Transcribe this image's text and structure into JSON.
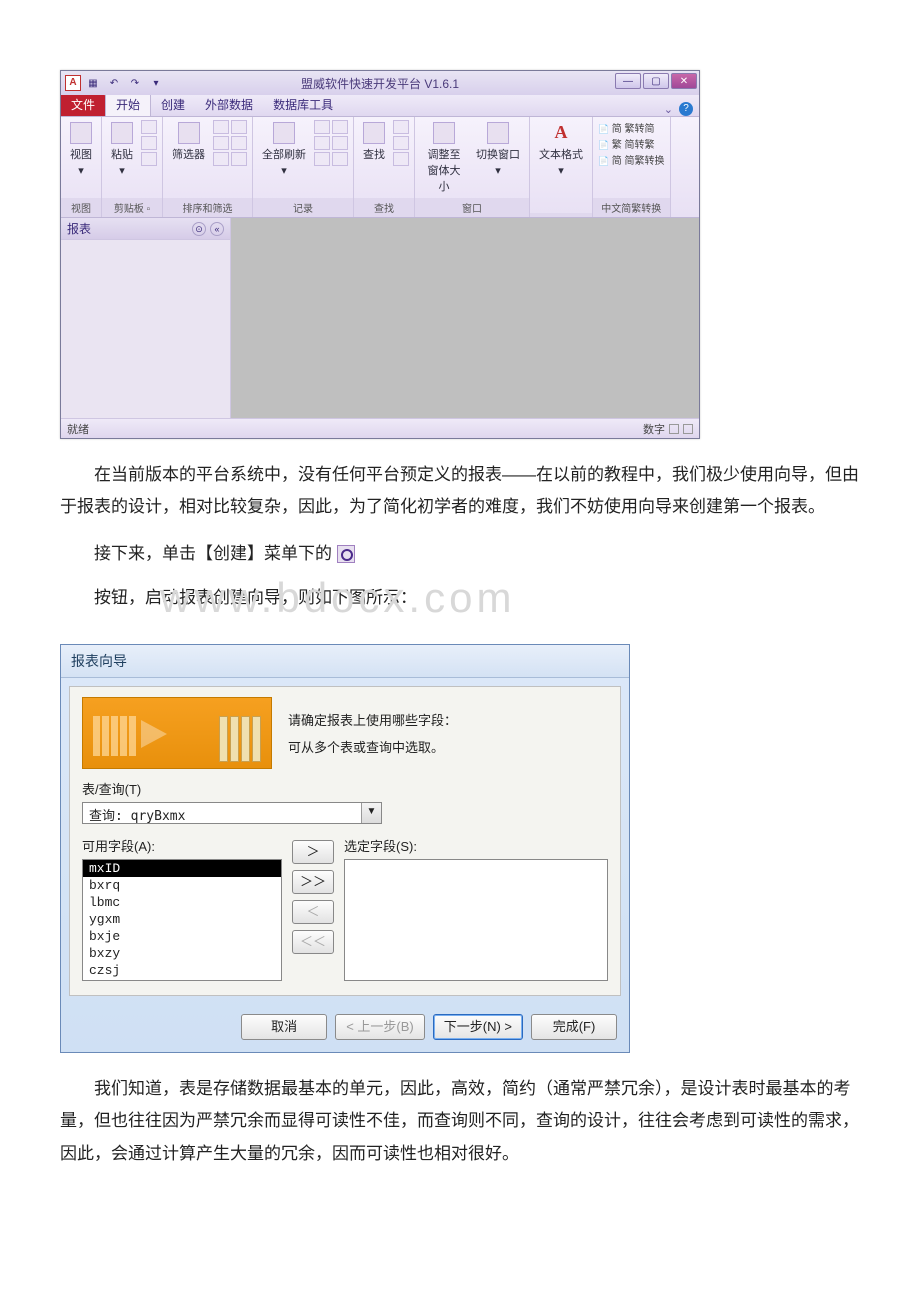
{
  "app": {
    "title": "盟威软件快速开发平台 V1.6.1",
    "logo_letter": "A",
    "qat": {
      "save": "▦",
      "undo": "↶",
      "redo": "↷",
      "more": "▾"
    },
    "win_controls": {
      "min": "—",
      "max": "▢",
      "close": "✕"
    }
  },
  "ribbon": {
    "tabs": {
      "file": "文件",
      "home": "开始",
      "create": "创建",
      "external": "外部数据",
      "dbtools": "数据库工具"
    },
    "help_chevron": "⌄",
    "help_q": "?",
    "groups": {
      "view": {
        "big": "视图",
        "drop": "▾",
        "label": "视图"
      },
      "clipboard": {
        "paste": "粘贴",
        "label": "剪贴板",
        "launcher": "▫"
      },
      "sortfilter": {
        "filter": "筛选器",
        "label": "排序和筛选"
      },
      "records": {
        "refresh": "全部刷新",
        "label": "记录"
      },
      "find": {
        "find": "查找",
        "label": "查找"
      },
      "window": {
        "resize": "调整至窗体大小",
        "switch": "切换窗口",
        "label": "窗口"
      },
      "textformat": {
        "letter": "A",
        "label_btn": "文本格式",
        "label": ""
      },
      "cjk": {
        "sjs": "简 繁转简",
        "jfs": "繁 简转繁",
        "jfswitch": "简 简繁转换",
        "label": "中文简繁转换"
      }
    }
  },
  "navpane": {
    "title": "报表",
    "collapse": "«",
    "menu": "⊙"
  },
  "statusbar": {
    "left": "就绪",
    "right": "数字"
  },
  "para1": "在当前版本的平台系统中，没有任何平台预定义的报表——在以前的教程中，我们极少使用向导，但由于报表的设计，相对比较复杂，因此，为了简化初学者的难度，我们不妨使用向导来创建第一个报表。",
  "para2a": "接下来，单击【创建】菜单下的 ",
  "para2b": "按钮，启动报表创建向导，则如下图所示：",
  "watermark": "www.bdocx.com",
  "wizard": {
    "title": "报表向导",
    "hint1": "请确定报表上使用哪些字段：",
    "hint2": "可从多个表或查询中选取。",
    "table_query_label": "表/查询(T)",
    "combo_value": "查询: qryBxmx",
    "combo_arrow": "▼",
    "available_label": "可用字段(A):",
    "selected_label": "选定字段(S):",
    "available": [
      "mxID",
      "bxrq",
      "lbmc",
      "ygxm",
      "bxje",
      "bxzy",
      "czsj"
    ],
    "move": {
      "add": "＞",
      "add_all": "＞＞",
      "remove": "＜",
      "remove_all": "＜＜"
    },
    "buttons": {
      "cancel": "取消",
      "back": "< 上一步(B)",
      "next": "下一步(N) >",
      "finish": "完成(F)"
    }
  },
  "para3": "我们知道，表是存储数据最基本的单元，因此，高效，简约（通常严禁冗余），是设计表时最基本的考量，但也往往因为严禁冗余而显得可读性不佳，而查询则不同，查询的设计，往往会考虑到可读性的需求，因此，会通过计算产生大量的冗余，因而可读性也相对很好。"
}
